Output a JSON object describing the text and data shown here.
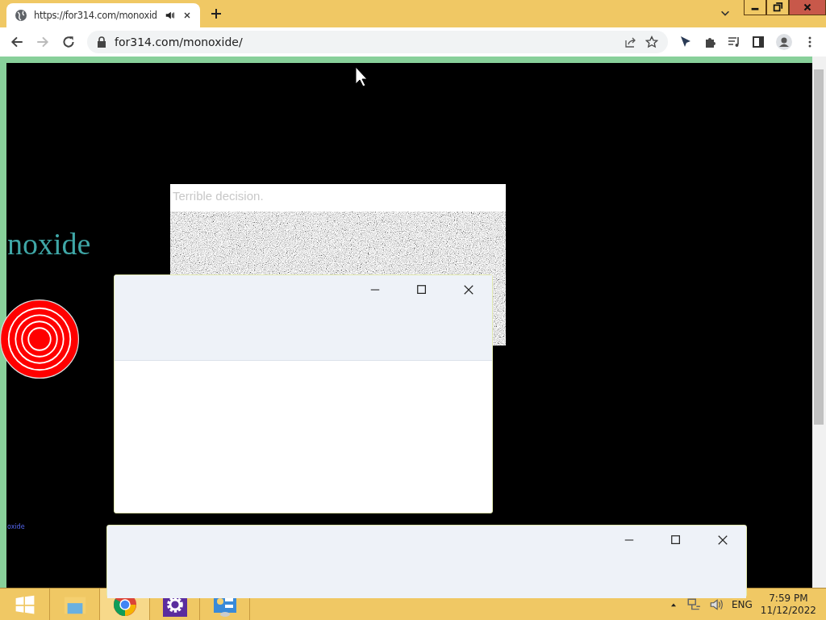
{
  "browser": {
    "tab": {
      "title": "https://for314.com/monoxid",
      "audio": true
    },
    "address": "for314.com/monoxide/"
  },
  "page": {
    "heading": "noxide",
    "link": "oxide",
    "image_window": {
      "title": "Terrible decision."
    }
  },
  "taskbar": {
    "language": "ENG",
    "time": "7:59 PM",
    "date": "11/12/2022"
  }
}
